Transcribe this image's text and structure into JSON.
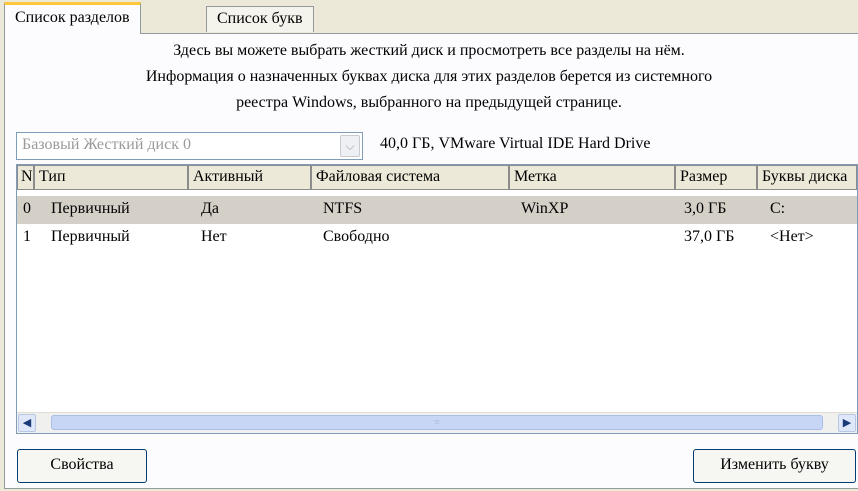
{
  "tabs": [
    {
      "label": "Список разделов",
      "active": true
    },
    {
      "label": "Список букв",
      "active": false
    }
  ],
  "description": {
    "line1": "Здесь вы можете выбрать жесткий диск и просмотреть все разделы на нём.",
    "line2": "Информация о назначенных буквах диска для этих разделов берется из системного",
    "line3": "реестра Windows, выбранного на предыдущей странице."
  },
  "disk_select": {
    "value": "Базовый Жесткий диск 0",
    "enabled": false
  },
  "disk_info": "40,0 ГБ, VMware Virtual IDE Hard Drive",
  "partitions": {
    "columns": [
      "N",
      "Тип",
      "Активный",
      "Файловая система",
      "Метка",
      "Размер",
      "Буквы диска"
    ],
    "rows": [
      {
        "n": "0",
        "type": "Первичный",
        "active": "Да",
        "fs": "NTFS",
        "label": "WinXP",
        "size": "3,0 ГБ",
        "letters": "C:",
        "selected": true
      },
      {
        "n": "1",
        "type": "Первичный",
        "active": "Нет",
        "fs": "Свободно",
        "label": "",
        "size": "37,0 ГБ",
        "letters": "<Нет>",
        "selected": false
      }
    ]
  },
  "buttons": {
    "properties": "Свойства",
    "change_letter": "Изменить букву"
  },
  "icons": {
    "scroll_left": "chevron-left-icon",
    "scroll_right": "chevron-right-icon",
    "dropdown": "chevron-down-icon"
  }
}
